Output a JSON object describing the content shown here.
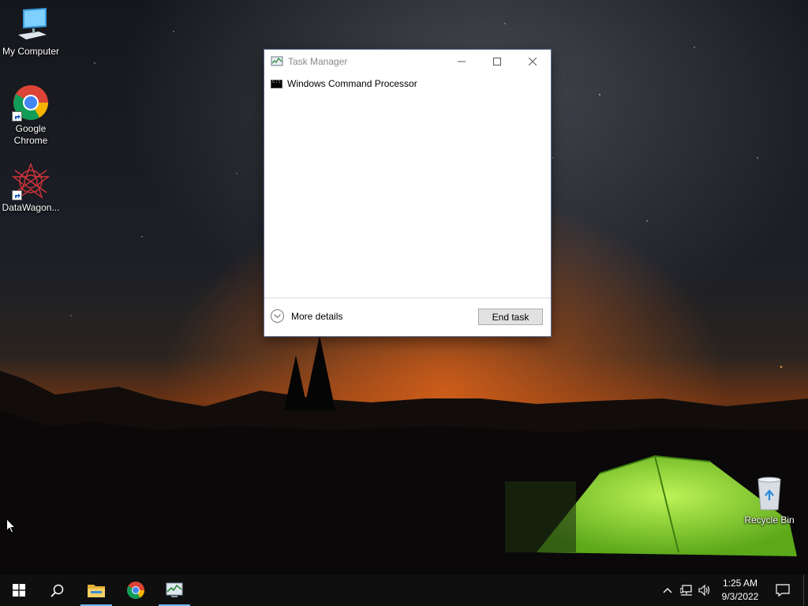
{
  "desktop": {
    "icons": [
      {
        "label": "My Computer",
        "icon": "computer-icon"
      },
      {
        "label": "Google Chrome",
        "icon": "chrome-icon"
      },
      {
        "label": "DataWagon...",
        "icon": "datawagon-icon"
      },
      {
        "label": "Recycle Bin",
        "icon": "recycle-bin-icon"
      }
    ]
  },
  "task_manager": {
    "title": "Task Manager",
    "processes": [
      {
        "name": "Windows Command Processor",
        "icon": "cmd-icon"
      }
    ],
    "more_details_label": "More details",
    "end_task_label": "End task"
  },
  "taskbar": {
    "buttons": [
      {
        "icon": "windows-start-icon"
      },
      {
        "icon": "search-icon"
      },
      {
        "icon": "file-explorer-icon",
        "running": true
      },
      {
        "icon": "chrome-icon"
      },
      {
        "icon": "task-manager-icon",
        "running": true
      }
    ],
    "tray": {
      "icons": [
        "chevron-up-icon",
        "network-icon",
        "volume-icon",
        "notification-icon"
      ],
      "time": "1:25 AM",
      "date": "9/3/2022"
    }
  },
  "colors": {
    "taskbar_bg": "#0f0f10",
    "running_indicator": "#76b9ed",
    "tent_green": "#8fe22a",
    "sunset_orange": "#e0641a"
  }
}
